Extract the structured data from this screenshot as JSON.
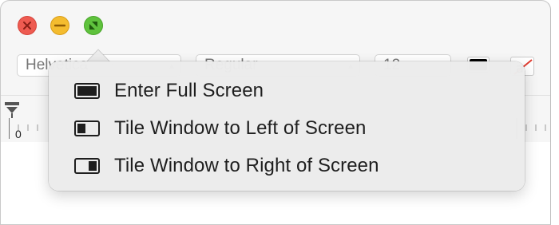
{
  "window": {
    "controls": [
      {
        "name": "close",
        "icon": "close-icon"
      },
      {
        "name": "minimize",
        "icon": "minimize-icon"
      },
      {
        "name": "zoom",
        "icon": "fullscreen-icon"
      }
    ]
  },
  "toolbar": {
    "font_family_value": "Helvetica",
    "font_style_value": "Regular",
    "font_size_value": "12",
    "text_color": "#000000"
  },
  "ruler": {
    "zero_label": "0"
  },
  "menu": {
    "items": [
      {
        "label": "Enter Full Screen",
        "icon": "full-screen-icon"
      },
      {
        "label": "Tile Window to Left of Screen",
        "icon": "tile-left-icon"
      },
      {
        "label": "Tile Window to Right of Screen",
        "icon": "tile-right-icon"
      }
    ]
  },
  "colors": {
    "close": "#ee5b51",
    "minimize": "#f4bc2f",
    "zoom": "#5fc23d"
  }
}
